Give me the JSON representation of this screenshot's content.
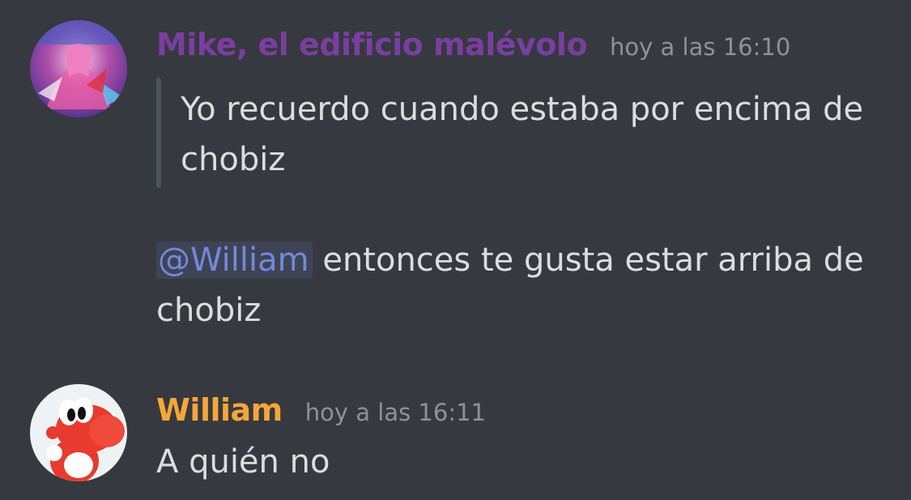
{
  "messages": [
    {
      "author": "Mike, el edificio malévolo",
      "author_color": "#7a3ea0",
      "timestamp": "hoy a las 16:10",
      "quote_lines": [
        "Yo recuerdo cuando estaba por encima de",
        "chobiz"
      ],
      "mention": "@William",
      "text_line1": "entonces te gusta estar arriba de",
      "text_line2": "chobiz"
    },
    {
      "author": "William",
      "author_color": "#f5a63a",
      "timestamp": "hoy a las 16:11",
      "text": "A quién no"
    }
  ],
  "colors": {
    "background": "#36393f",
    "text": "#dcddde",
    "timestamp": "#8e9297",
    "mention": "#7289da",
    "quote_bar": "#4f545c"
  }
}
